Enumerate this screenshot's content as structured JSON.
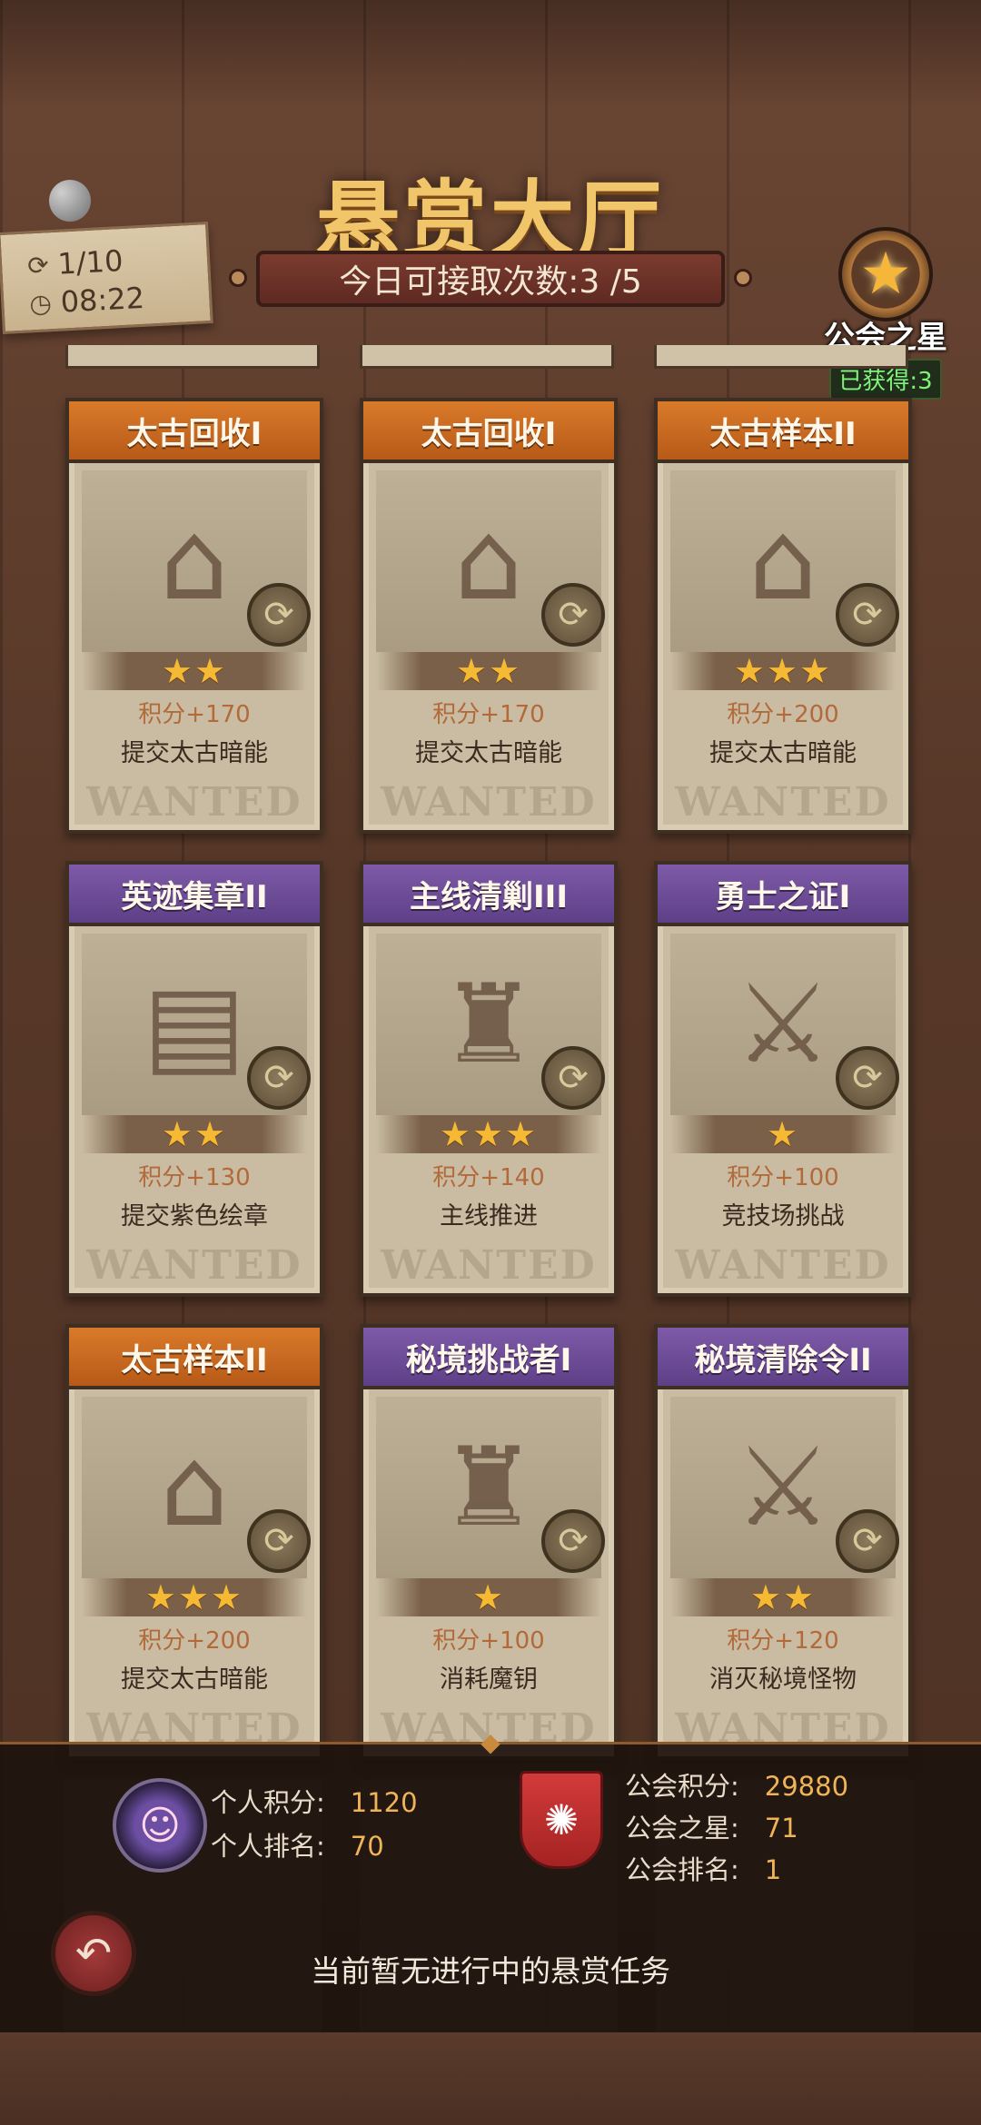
{
  "header": {
    "title": "悬赏大厅",
    "daily_attempts": "今日可接取次数:3 /5"
  },
  "status_note": {
    "refresh_count": "1/10",
    "timer": "08:22"
  },
  "guild_star": {
    "label": "公会之星",
    "obtained": "已获得:3"
  },
  "cards": [
    {
      "title": "太古回收I",
      "color": "orange",
      "stars": "★★",
      "score": "积分+170",
      "desc": "提交太古暗能",
      "wanted": "WANTED",
      "icon": "chest-stall-icon"
    },
    {
      "title": "太古回收I",
      "color": "orange",
      "stars": "★★",
      "score": "积分+170",
      "desc": "提交太古暗能",
      "wanted": "WANTED",
      "icon": "chest-stall-icon"
    },
    {
      "title": "太古样本II",
      "color": "orange",
      "stars": "★★★",
      "score": "积分+200",
      "desc": "提交太古暗能",
      "wanted": "WANTED",
      "icon": "chest-stall-icon"
    },
    {
      "title": "英迹集章II",
      "color": "purple",
      "stars": "★★",
      "score": "积分+130",
      "desc": "提交紫色绘章",
      "wanted": "WANTED",
      "icon": "map-stall-icon"
    },
    {
      "title": "主线清剿III",
      "color": "purple",
      "stars": "★★★",
      "score": "积分+140",
      "desc": "主线推进",
      "wanted": "WANTED",
      "icon": "altar-icon"
    },
    {
      "title": "勇士之证I",
      "color": "purple",
      "stars": "★",
      "score": "积分+100",
      "desc": "竞技场挑战",
      "wanted": "WANTED",
      "icon": "crossed-swords-icon"
    },
    {
      "title": "太古样本II",
      "color": "orange",
      "stars": "★★★",
      "score": "积分+200",
      "desc": "提交太古暗能",
      "wanted": "WANTED",
      "icon": "chest-stall-icon"
    },
    {
      "title": "秘境挑战者I",
      "color": "purple",
      "stars": "★",
      "score": "积分+100",
      "desc": "消耗魔钥",
      "wanted": "WANTED",
      "icon": "altar-icon"
    },
    {
      "title": "秘境清除令II",
      "color": "purple",
      "stars": "★★",
      "score": "积分+120",
      "desc": "消灭秘境怪物",
      "wanted": "WANTED",
      "icon": "crossed-swords-icon"
    }
  ],
  "bottom": {
    "personal_score_label": "个人积分:",
    "personal_score": "1120",
    "personal_rank_label": "个人排名:",
    "personal_rank": "70",
    "guild_score_label": "公会积分:",
    "guild_score": "29880",
    "guild_star_label": "公会之星:",
    "guild_star_count": "71",
    "guild_rank_label": "公会排名:",
    "guild_rank": "1",
    "empty_message": "当前暂无进行中的悬赏任务"
  },
  "colors": {
    "orange_header": "#d97a2a",
    "purple_header": "#7e5aa8",
    "star": "#f5b933",
    "score_value": "#f0b457"
  }
}
